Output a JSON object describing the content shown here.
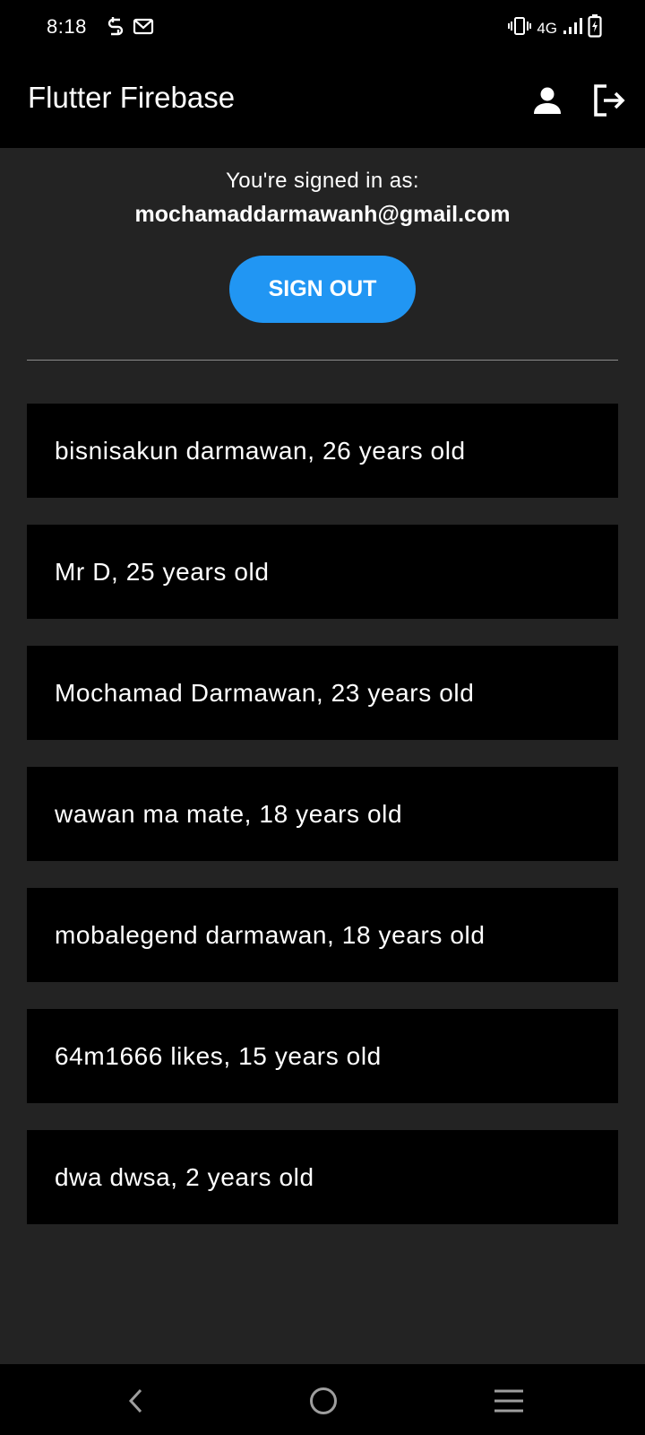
{
  "status_bar": {
    "time": "8:18",
    "network": "4G",
    "left_icons": [
      "sync-icon",
      "gmail-icon"
    ],
    "right_icons": [
      "vibrate-icon",
      "signal-icon",
      "battery-charging-icon"
    ]
  },
  "app_bar": {
    "title": "Flutter Firebase",
    "actions": [
      "person-icon",
      "logout-icon"
    ]
  },
  "auth": {
    "signed_in_label": "You're signed in as:",
    "email": "mochamaddarmawanh@gmail.com",
    "sign_out_label": "SIGN OUT"
  },
  "users": [
    "bisnisakun darmawan, 26 years old",
    "Mr D, 25 years old",
    "Mochamad Darmawan, 23 years old",
    "wawan ma mate, 18 years old",
    "mobalegend darmawan, 18 years old",
    "64m1666 likes, 15 years old",
    "dwa dwsa, 2 years old"
  ],
  "nav_bar": [
    "back-icon",
    "home-icon",
    "recents-icon"
  ],
  "colors": {
    "background": "#232323",
    "bars": "#000000",
    "accent": "#2196F3",
    "text": "#FFFFFF",
    "divider": "#8A8A8A"
  }
}
